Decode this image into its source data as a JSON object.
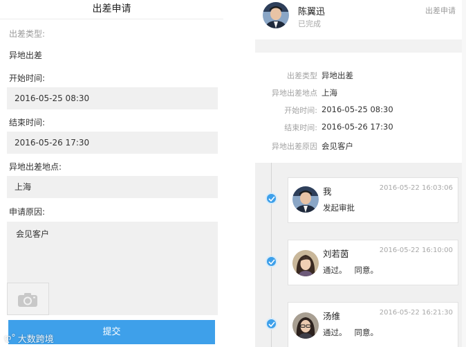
{
  "form": {
    "title": "出差申请",
    "trip_type_label": "出差类型:",
    "trip_type_value": "异地出差",
    "start_label": "开始时间:",
    "start_value": "2016-05-25 08:30",
    "end_label": "结束时间:",
    "end_value": "2016-05-26 17:30",
    "location_label": "异地出差地点:",
    "location_value": "上海",
    "reason_label": "申请原因:",
    "reason_value": "会见客户",
    "photo_icon": "camera-icon",
    "submit_label": "提交"
  },
  "watermark": {
    "text": "大数跨境",
    "icon": "weibo-logo-icon"
  },
  "detail": {
    "applicant_name": "陈翼迅",
    "status": "已完成",
    "request_type": "出差申请",
    "fields": [
      {
        "key": "出差类型",
        "value": "异地出差"
      },
      {
        "key": "异地出差地点",
        "value": "上海"
      },
      {
        "key": "开始时间:",
        "value": "2016-05-25 08:30"
      },
      {
        "key": "结束时间:",
        "value": "2016-05-26 17:30"
      },
      {
        "key": "异地出差原因",
        "value": "会见客户"
      }
    ]
  },
  "timeline": [
    {
      "name": "我",
      "time": "2016-05-22 16:03:06",
      "text": "发起审批",
      "check_icon": "check-icon"
    },
    {
      "name": "刘若茵",
      "time": "2016-05-22 16:10:00",
      "text": "通过。   同意。",
      "check_icon": "check-icon"
    },
    {
      "name": "汤维",
      "time": "2016-05-22 16:21:30",
      "text": "通过。   同意。",
      "check_icon": "check-icon"
    }
  ],
  "colors": {
    "accent": "#3ea0ea",
    "field_bg": "#f0f0f0",
    "muted_text": "#a3a3a3"
  }
}
